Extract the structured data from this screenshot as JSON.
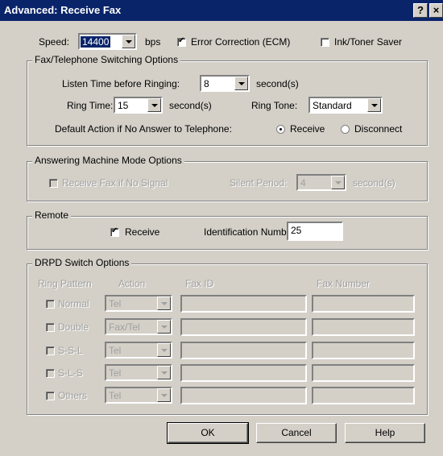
{
  "window": {
    "title": "Advanced: Receive Fax",
    "help_btn": "?",
    "close_btn": "×"
  },
  "speed": {
    "label": "Speed:",
    "value": "14400",
    "unit": "bps"
  },
  "ecm": {
    "label": "Error Correction (ECM)",
    "checked": true
  },
  "toner": {
    "label": "Ink/Toner Saver",
    "checked": false
  },
  "fax_tel": {
    "title": "Fax/Telephone Switching Options",
    "listen_label": "Listen Time before Ringing:",
    "listen_value": "8",
    "listen_unit": "second(s)",
    "ring_time_label": "Ring Time:",
    "ring_time_value": "15",
    "ring_time_unit": "second(s)",
    "ring_tone_label": "Ring Tone:",
    "ring_tone_value": "Standard",
    "default_action_label": "Default Action if No Answer to Telephone:",
    "receive_label": "Receive",
    "disconnect_label": "Disconnect",
    "selected": "Receive"
  },
  "answering": {
    "title": "Answering Machine Mode Options",
    "receive_if_no_signal": "Receive Fax if No Signal",
    "silent_label": "Silent Period:",
    "silent_value": "4",
    "silent_unit": "second(s)"
  },
  "remote": {
    "title": "Remote",
    "receive_label": "Receive",
    "receive_checked": true,
    "id_label": "Identification Number:",
    "id_value": "25"
  },
  "drpd": {
    "title": "DRPD Switch Options",
    "headers": {
      "pattern": "Ring Pattern",
      "action": "Action",
      "fax_id": "Fax ID",
      "fax_number": "Fax Number"
    },
    "rows": [
      {
        "pattern": "Normal",
        "action": "Tel"
      },
      {
        "pattern": "Double",
        "action": "Fax/Tel"
      },
      {
        "pattern": "S-S-L",
        "action": "Tel"
      },
      {
        "pattern": "S-L-S",
        "action": "Tel"
      },
      {
        "pattern": "Others",
        "action": "Tel"
      }
    ]
  },
  "buttons": {
    "ok": "OK",
    "cancel": "Cancel",
    "help": "Help"
  },
  "colors": {
    "title_bar": "#0a246a",
    "face": "#d4d0c8",
    "disabled_text": "#a0a0a0"
  }
}
